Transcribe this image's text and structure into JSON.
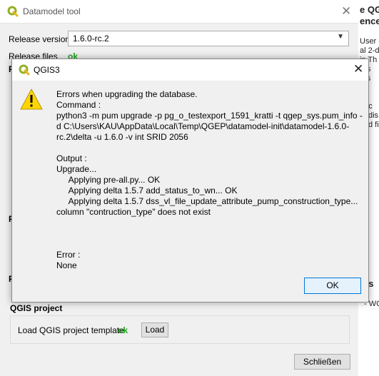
{
  "background_window": {
    "title": "Datamodel tool",
    "close_glyph": "✕",
    "release_version_label": "Release version",
    "release_version_value": "1.6.0-rc.2",
    "release_files_label": "Release files",
    "release_files_status": "ok",
    "fragments": [
      "P",
      "P",
      "P"
    ],
    "qgis_project_title": "QGIS project",
    "load_template_label": "Load QGIS project template",
    "load_template_status": "ok",
    "load_button": "Load",
    "close_button": "Schließen"
  },
  "right_window_fragments": {
    "lines": [
      "e QG",
      "ence",
      "User C",
      "al 2-da",
      "in Th",
      "res",
      "res",
      "et",
      "to",
      "unc",
      "dis",
      "d fi"
    ],
    "bottom_lines": [
      "res",
      "- WGS"
    ]
  },
  "dialog": {
    "title": "QGIS3",
    "close_glyph": "✕",
    "icon": "warning-icon",
    "message": "Errors when upgrading the database.\nCommand :\npython3 -m pum upgrade -p pg_o_testexport_1591_kratti -t qgep_sys.pum_info -d C:\\Users\\KAU\\AppData\\Local\\Temp\\QGEP\\datamodel-init\\datamodel-1.6.0-rc.2\\delta -u 1.6.0 -v int SRID 2056\n\nOutput :\nUpgrade...\n     Applying pre-all.py... OK\n     Applying delta 1.5.7 add_status_to_wn... OK\n     Applying delta 1.5.7 dss_vl_file_update_attribute_pump_construction_type...\ncolumn \"contruction_type\" does not exist\n\n\n\nError :\nNone",
    "ok_button": "OK"
  },
  "colors": {
    "status_ok": "#1aa31a",
    "qgis_green": "#93b023",
    "warning_yellow": "#ffd500",
    "ok_button_border": "#0078d7"
  }
}
